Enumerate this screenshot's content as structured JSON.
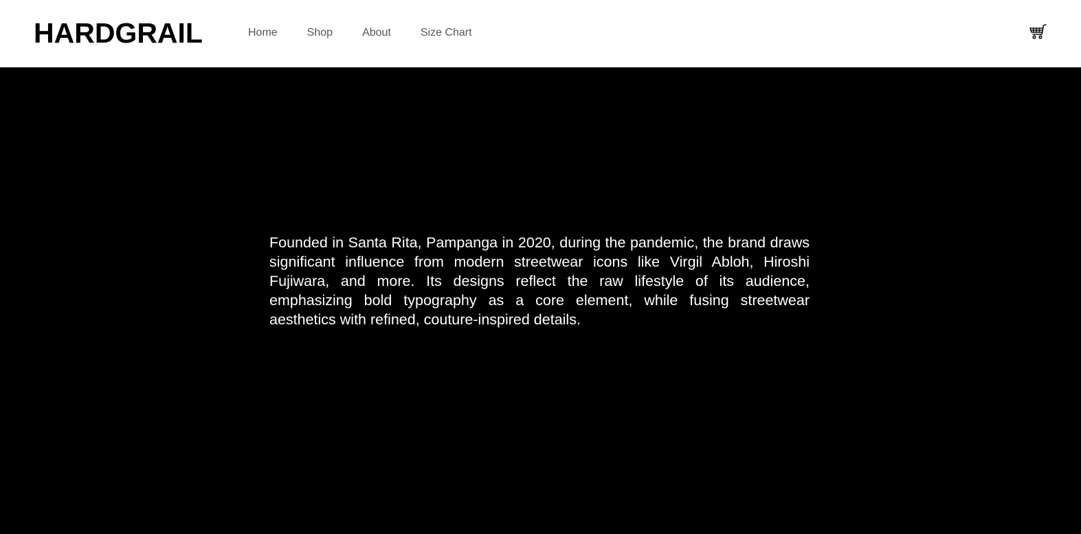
{
  "header": {
    "brand": "HARDGRAIL",
    "nav": [
      {
        "label": "Home"
      },
      {
        "label": "Shop"
      },
      {
        "label": "About"
      },
      {
        "label": "Size Chart"
      }
    ],
    "cart_icon": "shopping-cart-icon"
  },
  "about": {
    "text": "Founded in Santa Rita, Pampanga in 2020, during the pandemic, the brand draws significant influence from modern streetwear icons like Virgil Abloh, Hiroshi Fujiwara, and more. Its designs reflect the raw lifestyle of its audience, emphasizing bold typography as a core element, while fusing streetwear aesthetics with refined, couture-inspired details."
  },
  "colors": {
    "header_bg": "#ffffff",
    "page_bg": "#000000",
    "brand": "#000000",
    "nav_text": "#555555",
    "body_text": "#ffffff"
  }
}
